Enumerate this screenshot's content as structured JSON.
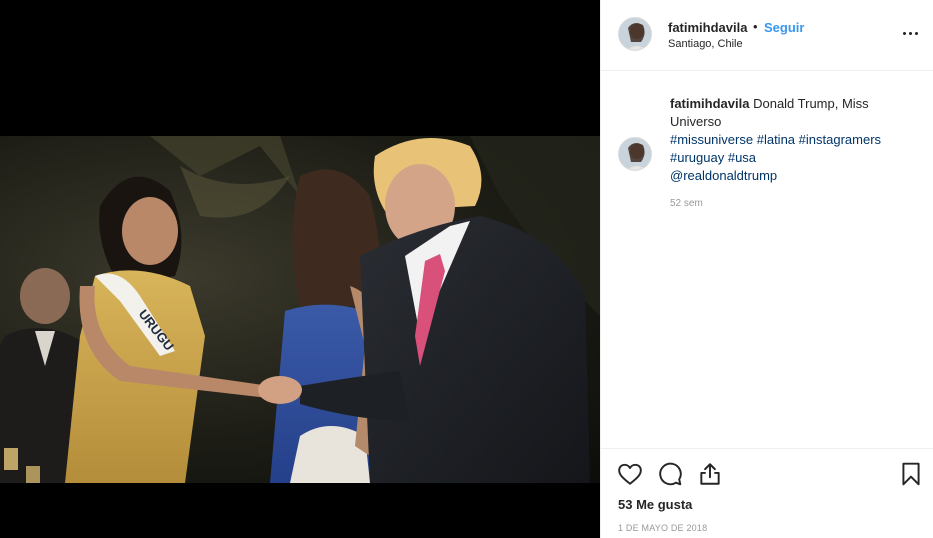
{
  "post": {
    "username": "fatimihdavila",
    "separator": "•",
    "follow_label": "Seguir",
    "location": "Santiago, Chile",
    "more_icon": "more-options-icon"
  },
  "photo": {
    "sash_text": "URUGU"
  },
  "caption": {
    "username": "fatimihdavila",
    "text": "Donald Trump, Miss Universo",
    "hashtags_line1": [
      "#missuniverse",
      "#latina",
      "#instagramers"
    ],
    "hashtags_line2": [
      "#uruguay",
      "#usa"
    ],
    "mention": "@realdonaldtrump",
    "time_ago": "52 sem"
  },
  "actions": {
    "like_icon": "heart-icon",
    "comment_icon": "comment-icon",
    "share_icon": "share-icon",
    "save_icon": "bookmark-icon",
    "likes_text": "53 Me gusta",
    "date_text": "1 DE MAYO DE 2018"
  },
  "colors": {
    "link": "#3897f0",
    "tag": "#003569",
    "text": "#262626",
    "muted": "#999999"
  }
}
